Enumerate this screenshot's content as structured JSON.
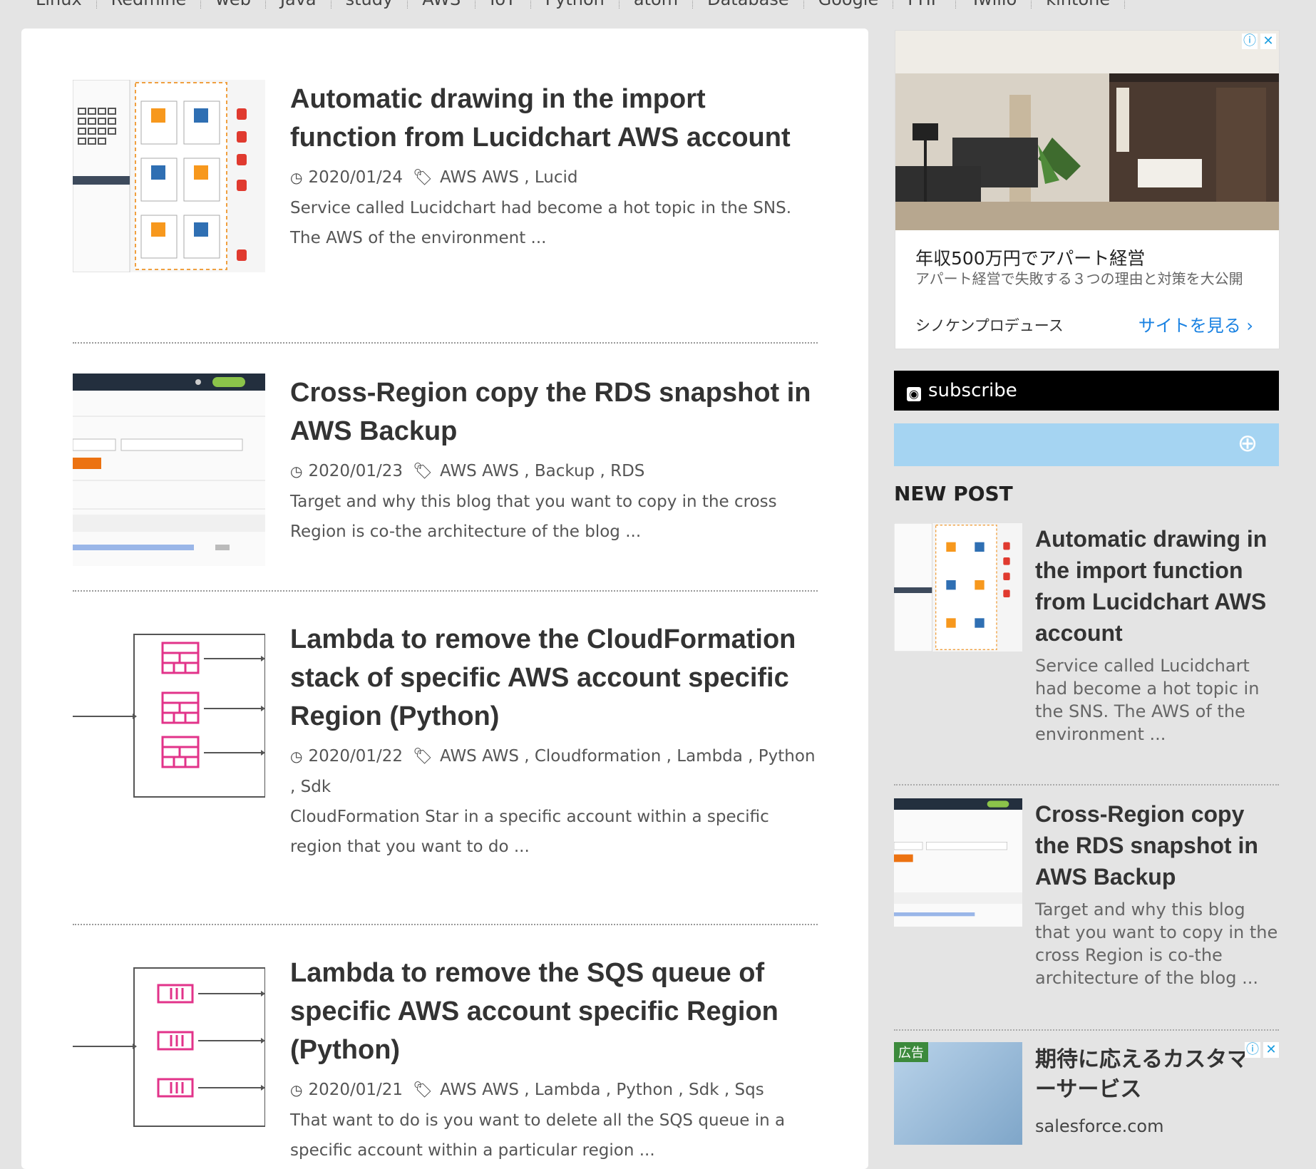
{
  "nav": {
    "items": [
      "Linux",
      "Redmine",
      "web",
      "Java",
      "study",
      "AWS",
      "IoT",
      "Python",
      "atom",
      "Database",
      "Google",
      "PHP",
      "Twilio",
      "kintone"
    ]
  },
  "posts": [
    {
      "title": "Automatic drawing in the import function from Lucidchart AWS account",
      "date": "2020/01/24",
      "tags": "AWS AWS , Lucid",
      "excerpt": "Service called Lucidchart had become a hot topic in the SNS. The AWS of the environment ..."
    },
    {
      "title": "Cross-Region copy the RDS snapshot in AWS Backup",
      "date": "2020/01/23",
      "tags": "AWS AWS , Backup , RDS",
      "excerpt": "Target and why this blog that you want to copy in the cross Region is co-the architecture of the blog ..."
    },
    {
      "title": "Lambda to remove the CloudFormation stack of specific AWS account specific Region (Python)",
      "date": "2020/01/22",
      "tags": "AWS AWS , Cloudformation , Lambda , Python , Sdk",
      "excerpt": "CloudFormation Star in a specific account within a specific region that you want to do ..."
    },
    {
      "title": "Lambda to remove the SQS queue of specific AWS account specific Region (Python)",
      "date": "2020/01/21",
      "tags": "AWS AWS , Lambda , Python , Sdk , Sqs",
      "excerpt": "That want to do is you want to delete all the SQS queue in a specific account within a particular region ..."
    }
  ],
  "ad_top": {
    "headline": "年収500万円でアパート経営",
    "description": "アパート経営で失敗する３つの理由と対策を大公開",
    "brand": "シノケンプロデュース",
    "cta": "サイトを見る ›"
  },
  "sidebar": {
    "subscribe_label": "subscribe",
    "search_placeholder": "",
    "new_post_heading": "NEW POST",
    "new_posts": [
      {
        "title": "Automatic drawing in the import function from Lucidchart AWS account",
        "excerpt": "Service called Lucidchart had become a hot topic in the SNS. The AWS of the environment ..."
      },
      {
        "title": "Cross-Region copy the RDS snapshot in AWS Backup",
        "excerpt": "Target and why this blog that you want to copy in the cross Region is co-the architecture of the blog ..."
      }
    ]
  },
  "ad_bottom": {
    "label": "広告",
    "title": "期待に応えるカスタマーサービス",
    "domain": "salesforce.com"
  },
  "colors": {
    "accent_blue": "#1a82e2",
    "search_bg": "#a5d4f2",
    "page_bg": "#e4e4e4"
  }
}
